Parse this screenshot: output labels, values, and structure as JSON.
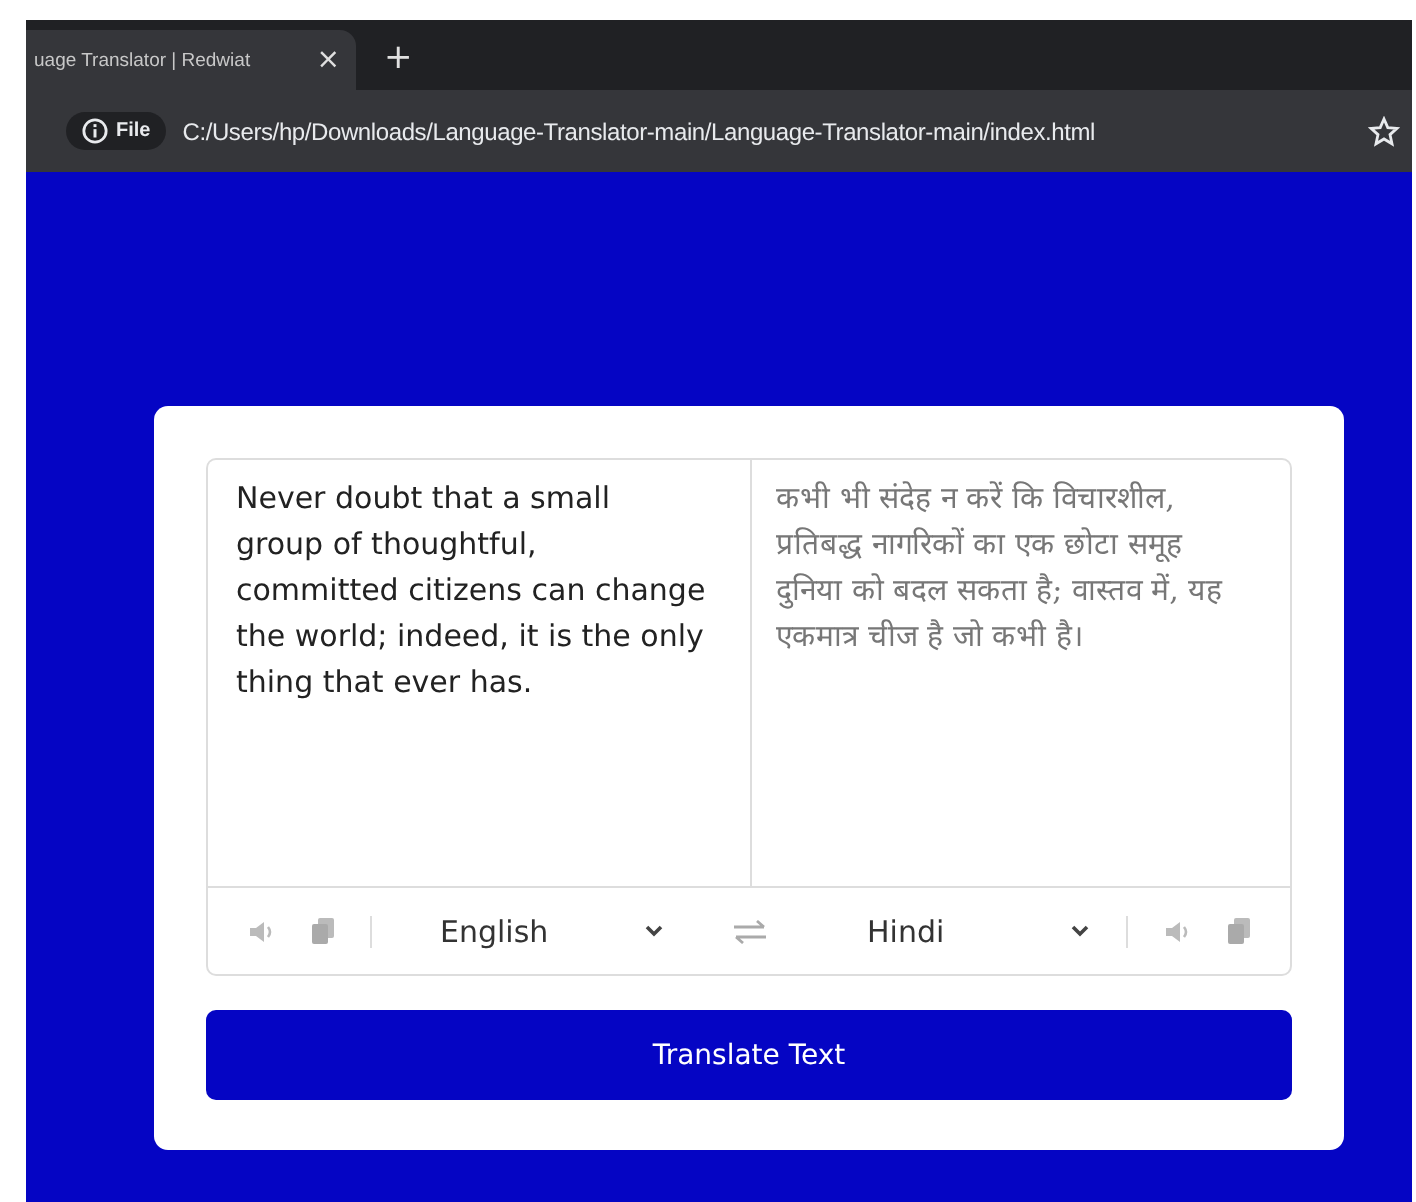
{
  "browser": {
    "tab": {
      "title": "uage Translator | Redwiat",
      "close": "×",
      "new_tab": "+"
    },
    "address_bar": {
      "badge": "File",
      "url": "C:/Users/hp/Downloads/Language-Translator-main/Language-Translator-main/index.html"
    }
  },
  "translator": {
    "source_text": "Never doubt that a small group of thoughtful, committed citizens can change the world; indeed, it is the only thing that ever has.",
    "target_text": "कभी भी संदेह न करें कि विचारशील, प्रतिबद्ध नागरिकों का एक छोटा समूह दुनिया को बदल सकता है; वास्तव में, यह एकमात्र चीज है जो कभी है।",
    "source_language": "English",
    "target_language": "Hindi",
    "button": "Translate Text"
  }
}
